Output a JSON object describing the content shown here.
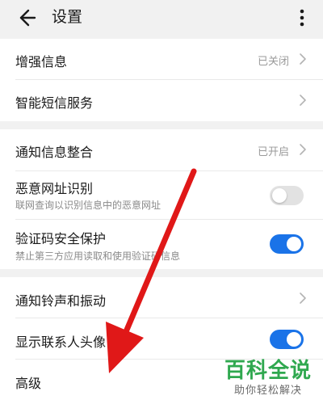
{
  "header": {
    "title": "设置",
    "back_icon": "arrow-left-icon",
    "more_icon": "more-vertical-icon"
  },
  "sections": [
    {
      "rows": [
        {
          "label": "增强信息",
          "value": "已关闭",
          "type": "chevron"
        },
        {
          "label": "智能短信服务",
          "type": "chevron"
        }
      ]
    },
    {
      "rows": [
        {
          "label": "通知信息整合",
          "value": "已开启",
          "type": "chevron"
        },
        {
          "label": "恶意网址识别",
          "sub": "联网查询以识别信息中的恶意网址",
          "type": "toggle",
          "on": false
        },
        {
          "label": "验证码安全保护",
          "sub": "禁止第三方应用读取和使用验证码信息",
          "type": "toggle",
          "on": true
        }
      ]
    },
    {
      "rows": [
        {
          "label": "通知铃声和振动",
          "type": "chevron"
        },
        {
          "label": "显示联系人头像",
          "type": "toggle",
          "on": true
        },
        {
          "label": "高级",
          "type": "plain"
        }
      ]
    }
  ],
  "watermark": {
    "logo_text": "百科全说",
    "tagline": "助你轻松解决"
  },
  "colors": {
    "background": "#f1f1f1",
    "card": "#ffffff",
    "toggle_on": "#1a73e8",
    "toggle_off": "#e2e2e2",
    "annotation_arrow": "#e01818",
    "watermark_green": "#2fa84f"
  },
  "annotation": "red-arrow-pointing-down"
}
